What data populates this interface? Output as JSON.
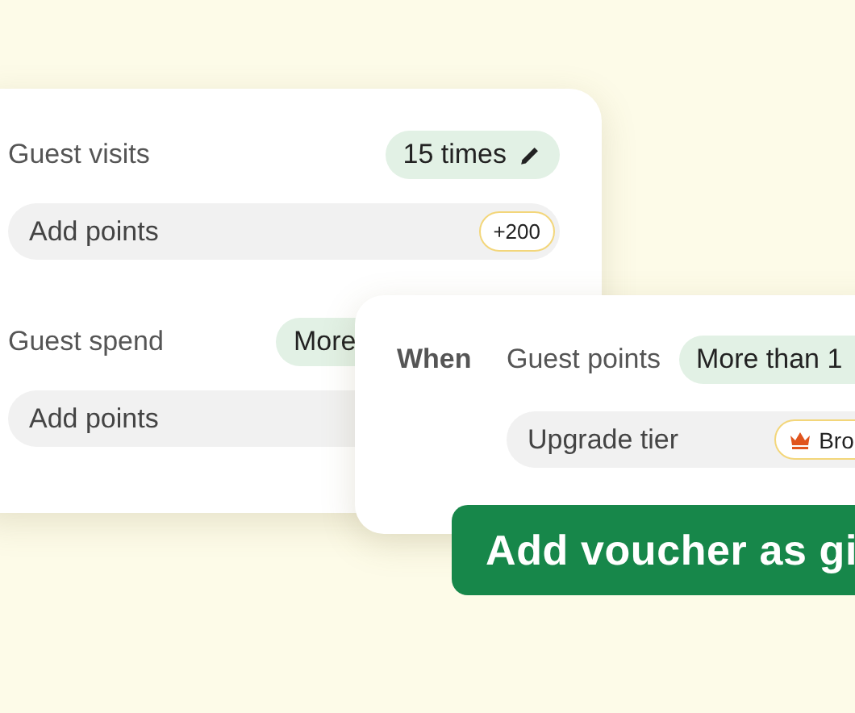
{
  "rules": [
    {
      "label": "Guest visits",
      "condition": {
        "text": "15 times",
        "editable": true
      },
      "action": {
        "label": "Add points",
        "badge": {
          "kind": "points",
          "text": "+200"
        }
      }
    },
    {
      "label": "Guest spend",
      "condition": {
        "text": "More"
      },
      "action": {
        "label": "Add points"
      }
    }
  ],
  "popup": {
    "prefix": "When",
    "label": "Guest points",
    "condition": {
      "text": "More than 1"
    },
    "action": {
      "label": "Upgrade tier",
      "badge": {
        "kind": "tier",
        "text": "Bro"
      }
    }
  },
  "gift_button": {
    "label": "Add voucher as gi"
  }
}
